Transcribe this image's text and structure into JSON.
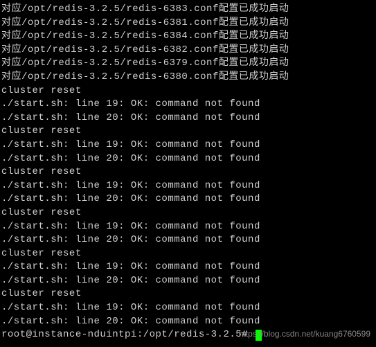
{
  "lines": [
    "对应/opt/redis-3.2.5/redis-6383.conf配置已成功启动",
    "对应/opt/redis-3.2.5/redis-6381.conf配置已成功启动",
    "对应/opt/redis-3.2.5/redis-6384.conf配置已成功启动",
    "对应/opt/redis-3.2.5/redis-6382.conf配置已成功启动",
    "对应/opt/redis-3.2.5/redis-6379.conf配置已成功启动",
    "对应/opt/redis-3.2.5/redis-6380.conf配置已成功启动",
    "cluster reset",
    "./start.sh: line 19: OK: command not found",
    "./start.sh: line 20: OK: command not found",
    "cluster reset",
    "./start.sh: line 19: OK: command not found",
    "./start.sh: line 20: OK: command not found",
    "cluster reset",
    "./start.sh: line 19: OK: command not found",
    "./start.sh: line 20: OK: command not found",
    "cluster reset",
    "./start.sh: line 19: OK: command not found",
    "./start.sh: line 20: OK: command not found",
    "cluster reset",
    "./start.sh: line 19: OK: command not found",
    "./start.sh: line 20: OK: command not found",
    "cluster reset",
    "./start.sh: line 19: OK: command not found",
    "./start.sh: line 20: OK: command not found"
  ],
  "prompt": "root@instance-nduintpi:/opt/redis-3.2.5# ",
  "watermark": "https://blog.csdn.net/kuang6760599"
}
